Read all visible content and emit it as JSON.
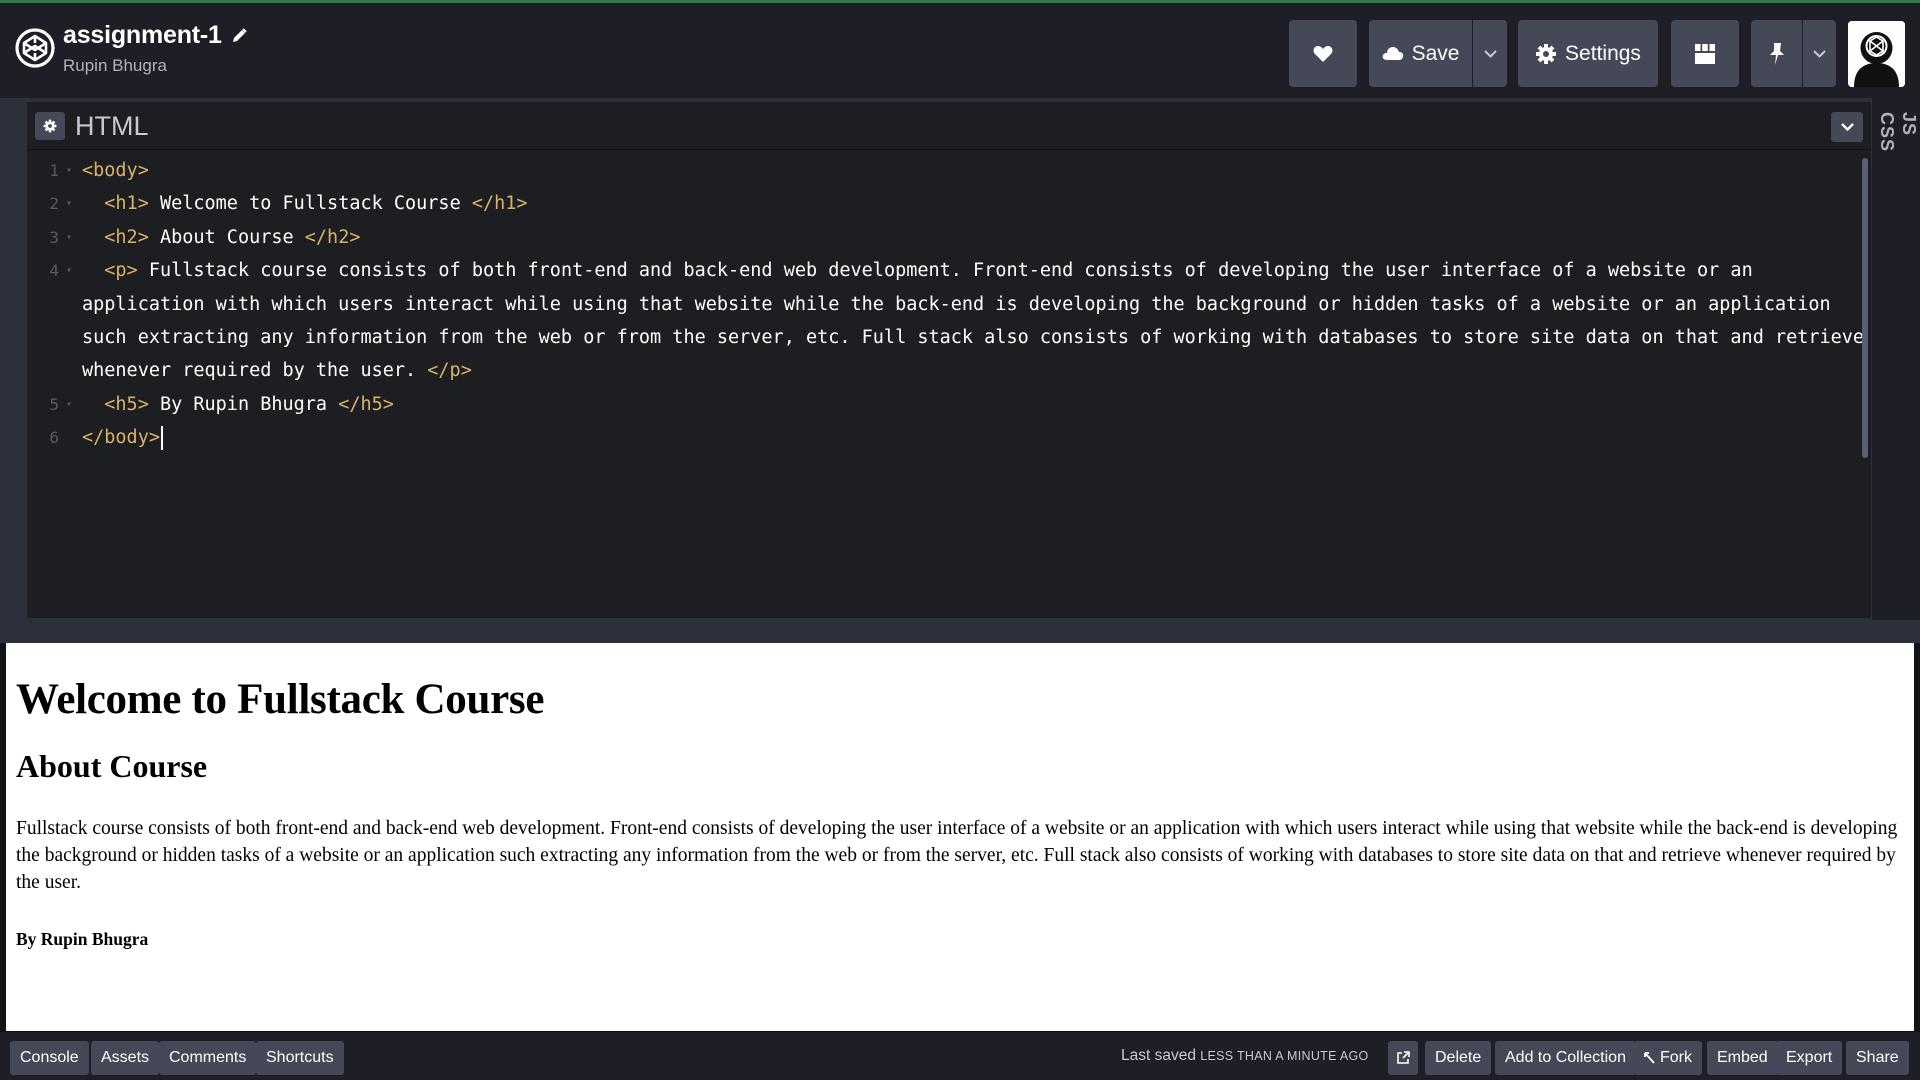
{
  "header": {
    "pen_title": "assignment-1",
    "author": "Rupin Bhugra",
    "save_label": "Save",
    "settings_label": "Settings"
  },
  "editor": {
    "title": "HTML",
    "side_tabs": [
      "CSS",
      "JS"
    ],
    "lines": [
      {
        "num": "1",
        "segments": [
          {
            "t": "<body>",
            "tag": true
          }
        ]
      },
      {
        "num": "2",
        "segments": [
          {
            "t": "  ",
            "tag": false
          },
          {
            "t": "<h1>",
            "tag": true
          },
          {
            "t": " Welcome to Fullstack Course ",
            "tag": false
          },
          {
            "t": "</h1>",
            "tag": true
          }
        ]
      },
      {
        "num": "3",
        "segments": [
          {
            "t": "  ",
            "tag": false
          },
          {
            "t": "<h2>",
            "tag": true
          },
          {
            "t": " About Course ",
            "tag": false
          },
          {
            "t": "</h2>",
            "tag": true
          }
        ]
      },
      {
        "num": "4",
        "segments": [
          {
            "t": "  ",
            "tag": false
          },
          {
            "t": "<p>",
            "tag": true
          },
          {
            "t": " Fullstack course consists of both front-end and back-end web development. Front-end consists of developing the user interface of a website or an application with which users interact while using that website while the back-end is developing the background or hidden tasks of a website or an application such extracting any information from the web or from the server, etc. Full stack also consists of working with databases to store site data on that and retrieve whenever required by the user. ",
            "tag": false
          },
          {
            "t": "</p>",
            "tag": true
          }
        ]
      },
      {
        "num": "5",
        "segments": [
          {
            "t": "  ",
            "tag": false
          },
          {
            "t": "<h5>",
            "tag": true
          },
          {
            "t": " By Rupin Bhugra ",
            "tag": false
          },
          {
            "t": "</h5>",
            "tag": true
          }
        ]
      },
      {
        "num": "6",
        "segments": [
          {
            "t": "</body>",
            "tag": true
          }
        ]
      }
    ]
  },
  "preview": {
    "h1": "Welcome to Fullstack Course",
    "h2": "About Course",
    "p": "Fullstack course consists of both front-end and back-end web development. Front-end consists of developing the user interface of a website or an application with which users interact while using that website while the back-end is developing the background or hidden tasks of a website or an application such extracting any information from the web or from the server, etc. Full stack also consists of working with databases to store site data on that and retrieve whenever required by the user.",
    "h5": "By Rupin Bhugra"
  },
  "footer": {
    "console": "Console",
    "assets": "Assets",
    "comments": "Comments",
    "shortcuts": "Shortcuts",
    "last_saved_label": "Last saved",
    "last_saved_time": "LESS THAN A MINUTE AGO",
    "delete": "Delete",
    "add_to_collection": "Add to Collection",
    "fork": "Fork",
    "embed": "Embed",
    "export": "Export",
    "share": "Share"
  },
  "colors": {
    "header_bg": "#1e1f26",
    "editor_bg": "#1d1e22",
    "button_bg": "#444857",
    "tag_color": "#d9b167"
  }
}
